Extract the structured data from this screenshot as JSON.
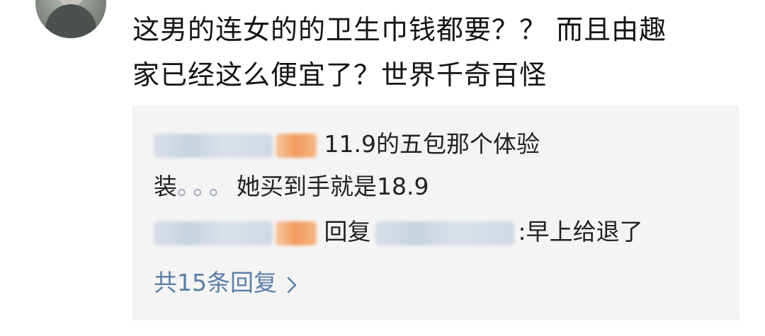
{
  "comment": {
    "line1": "这男的连女的的卫生巾钱都要？？ 而且由趣",
    "line2": "家已经这么便宜了？世界千奇百怪"
  },
  "replies": [
    {
      "text_a": "11.9的五包那个体验",
      "text_b_prefix": "装",
      "text_b_dots": "。。。",
      "text_b": "她买到手就是18.9"
    },
    {
      "reply_label": "回复",
      "text": ":早上给退了"
    }
  ],
  "more": {
    "label": "共15条回复",
    "icon": "chevron-right-icon"
  }
}
